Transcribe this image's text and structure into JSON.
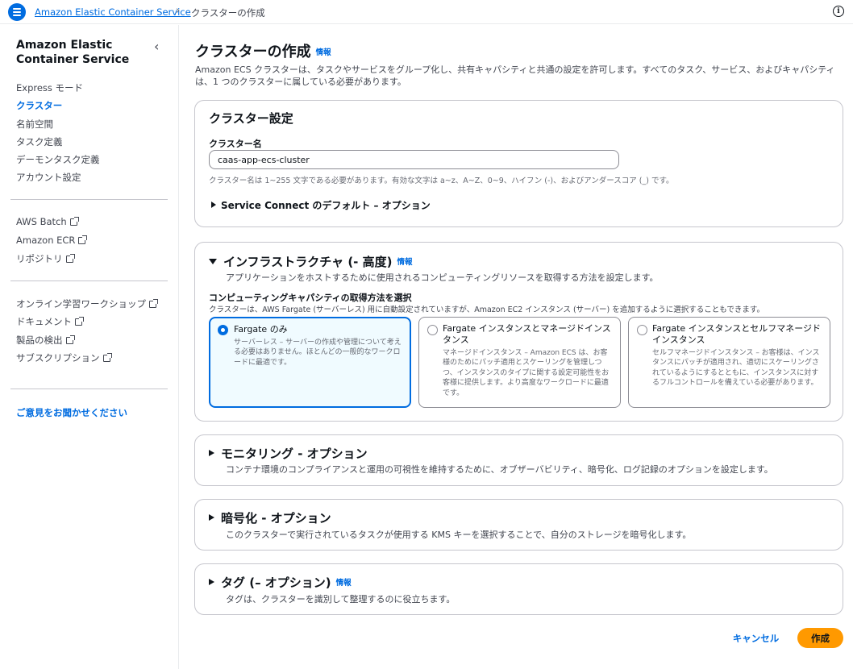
{
  "topbar": {
    "breadcrumb_root": "Amazon Elastic Container Service",
    "breadcrumb_current": "クラスターの作成"
  },
  "sidebar": {
    "title": "Amazon Elastic Container Service",
    "items": [
      {
        "label": "Express モード"
      },
      {
        "label": "クラスター",
        "active": true
      },
      {
        "label": "名前空間"
      },
      {
        "label": "タスク定義"
      },
      {
        "label": "デーモンタスク定義"
      },
      {
        "label": "アカウント設定"
      }
    ],
    "external_links": [
      {
        "label": "AWS Batch"
      },
      {
        "label": "Amazon ECR"
      },
      {
        "label": "リポジトリ"
      }
    ],
    "resource_links": [
      {
        "label": "オンライン学習ワークショップ"
      },
      {
        "label": "ドキュメント"
      },
      {
        "label": "製品の検出"
      },
      {
        "label": "サブスクリプション"
      }
    ],
    "feedback": "ご意見をお聞かせください"
  },
  "page": {
    "title": "クラスターの作成",
    "info": "情報",
    "description": "Amazon ECS クラスターは、タスクやサービスをグループ化し、共有キャパシティと共通の設定を許可します。すべてのタスク、サービス、およびキャパシティは、1 つのクラスターに属している必要があります。"
  },
  "cluster_settings": {
    "heading": "クラスター設定",
    "name_label": "クラスター名",
    "name_value": "caas-app-ecs-cluster",
    "name_constraint": "クラスター名は 1~255 文字である必要があります。有効な文字は a~z、A~Z、0~9、ハイフン (-)、およびアンダースコア (_) です。",
    "service_connect": "Service Connect のデフォルト – オプション"
  },
  "infrastructure": {
    "heading": "インフラストラクチャ (- 高度)",
    "info": "情報",
    "description": "アプリケーションをホストするために使用されるコンピューティングリソースを取得する方法を設定します。",
    "question": "コンピューティングキャパシティの取得方法を選択",
    "question_desc": "クラスターは、AWS Fargate (サーバーレス) 用に自動設定されていますが、Amazon EC2 インスタンス (サーバー) を追加するように選択することもできます。",
    "options": [
      {
        "title": "Fargate のみ",
        "description": "サーバーレス – サーバーの作成や管理について考える必要はありません。ほとんどの一般的なワークロードに最適です。",
        "selected": true
      },
      {
        "title": "Fargate インスタンスとマネージドインスタンス",
        "description": "マネージドインスタンス – Amazon ECS は、お客様のためにパッチ適用とスケーリングを管理しつつ、インスタンスのタイプに関する設定可能性をお客様に提供します。より高度なワークロードに最適です。",
        "selected": false
      },
      {
        "title": "Fargate インスタンスとセルフマネージドインスタンス",
        "description": "セルフマネージドインスタンス – お客様は、インスタンスにパッチが適用され、適切にスケーリングされているようにするとともに、インスタンスに対するフルコントロールを備えている必要があります。",
        "selected": false
      }
    ]
  },
  "monitoring": {
    "heading": "モニタリング - オプション",
    "description": "コンテナ環境のコンプライアンスと運用の可視性を維持するために、オブザーバビリティ、暗号化、ログ記録のオプションを設定します。"
  },
  "encryption": {
    "heading": "暗号化 - オプション",
    "description": "このクラスターで実行されているタスクが使用する KMS キーを選択することで、自分のストレージを暗号化します。"
  },
  "tags": {
    "heading": "タグ (– オプション)",
    "info": "情報",
    "description": "タグは、クラスターを識別して整理するのに役立ちます。"
  },
  "actions": {
    "cancel": "キャンセル",
    "create": "作成"
  },
  "colors": {
    "accent": "#006ce0",
    "primary_button": "#ff9900"
  }
}
